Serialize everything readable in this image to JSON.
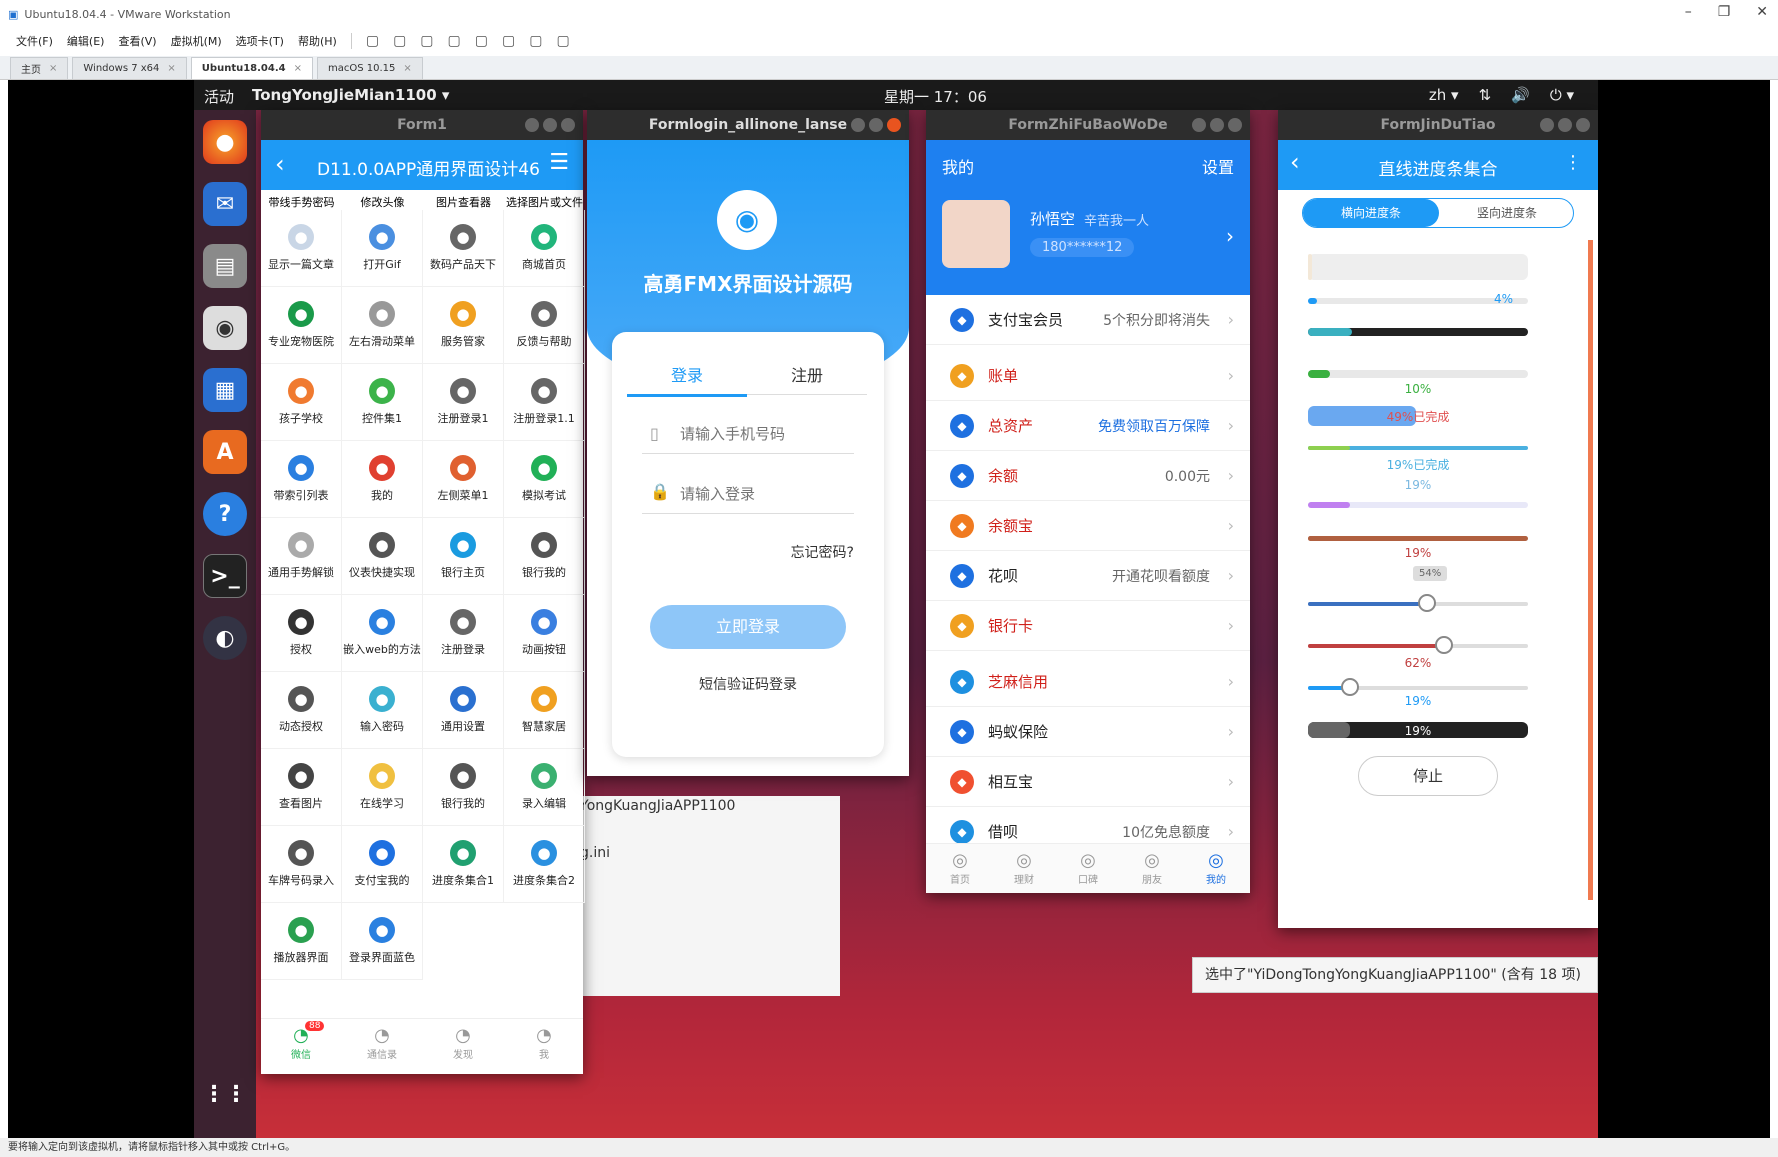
{
  "vmware": {
    "title": "Ubuntu18.04.4 - VMware Workstation",
    "menu": [
      "文件(F)",
      "编辑(E)",
      "查看(V)",
      "虚拟机(M)",
      "选项卡(T)",
      "帮助(H)"
    ],
    "tabs": [
      {
        "label": "主页"
      },
      {
        "label": "Windows 7 x64"
      },
      {
        "label": "Ubuntu18.04.4"
      },
      {
        "label": "macOS 10.15"
      }
    ],
    "status": "要将输入定向到该虚拟机，请将鼠标指针移入其中或按 Ctrl+G。"
  },
  "ubuntu": {
    "activities": "活动",
    "app_menu": "TongYongJieMian1100 ▾",
    "clock": "星期一 17：06",
    "lang": "zh ▾"
  },
  "form1": {
    "title": "Form1",
    "header": "D11.0.0APP通用界面设计46",
    "top_labels": [
      "带线手势密码",
      "修改头像",
      "图片查看器",
      "选择图片或文件"
    ],
    "items": [
      {
        "label": "显示一篇文章",
        "icon": "document-icon",
        "color": "#c9d6e6"
      },
      {
        "label": "打开Gif",
        "icon": "flame-icon",
        "color": "#4a8fe0"
      },
      {
        "label": "数码产品天下",
        "icon": "link-icon",
        "color": "#666"
      },
      {
        "label": "商城首页",
        "icon": "shop-icon",
        "color": "#21b57b"
      },
      {
        "label": "专业宠物医院",
        "icon": "aperture-icon",
        "color": "#1a9a4a"
      },
      {
        "label": "左右滑动菜单",
        "icon": "swipe-icon",
        "color": "#999"
      },
      {
        "label": "服务管家",
        "icon": "service-icon",
        "color": "#f0a020"
      },
      {
        "label": "反馈与帮助",
        "icon": "help-icon",
        "color": "#666"
      },
      {
        "label": "孩子学校",
        "icon": "school-icon",
        "color": "#f07a30"
      },
      {
        "label": "控件集1",
        "icon": "toggle-icon",
        "color": "#3cb34a"
      },
      {
        "label": "注册登录1",
        "icon": "user-add-icon",
        "color": "#666"
      },
      {
        "label": "注册登录1.1",
        "icon": "user-add-icon",
        "color": "#666"
      },
      {
        "label": "带索引列表",
        "icon": "list-icon",
        "color": "#2a7fe0"
      },
      {
        "label": "我的",
        "icon": "mail-icon",
        "color": "#e04030"
      },
      {
        "label": "左侧菜单1",
        "icon": "clipboard-icon",
        "color": "#e06030"
      },
      {
        "label": "模拟考试",
        "icon": "chat-icon",
        "color": "#21b057"
      },
      {
        "label": "通用手势解锁",
        "icon": "phone-icon",
        "color": "#aaa"
      },
      {
        "label": "仪表快捷实现",
        "icon": "compass-icon",
        "color": "#555"
      },
      {
        "label": "银行主页",
        "icon": "pie-icon",
        "color": "#1a9be0"
      },
      {
        "label": "银行我的",
        "icon": "user-icon",
        "color": "#555"
      },
      {
        "label": "授权",
        "icon": "layers-icon",
        "color": "#333"
      },
      {
        "label": "嵌入web的方法",
        "icon": "globe-icon",
        "color": "#2a80e0"
      },
      {
        "label": "注册登录",
        "icon": "send-icon",
        "color": "#666"
      },
      {
        "label": "动画按钮",
        "icon": "gauge-icon",
        "color": "#3a7fe0"
      },
      {
        "label": "动态授权",
        "icon": "camera-icon",
        "color": "#555"
      },
      {
        "label": "输入密码",
        "icon": "fingerprint-icon",
        "color": "#3ab0d0"
      },
      {
        "label": "通用设置",
        "icon": "gear-icon",
        "color": "#2a70d0"
      },
      {
        "label": "智慧家居",
        "icon": "home-icon",
        "color": "#f0a020"
      },
      {
        "label": "查看图片",
        "icon": "image-icon",
        "color": "#444"
      },
      {
        "label": "在线学习",
        "icon": "book-icon",
        "color": "#f0c040"
      },
      {
        "label": "银行我的",
        "icon": "user-icon",
        "color": "#555"
      },
      {
        "label": "录入编辑",
        "icon": "edit-icon",
        "color": "#3ab070"
      },
      {
        "label": "车牌号码录入",
        "icon": "plate-icon",
        "color": "#555"
      },
      {
        "label": "支付宝我的",
        "icon": "alipay-icon",
        "color": "#1e70e0"
      },
      {
        "label": "进度条集合1",
        "icon": "progress-icon",
        "color": "#20a070"
      },
      {
        "label": "进度条集合2",
        "icon": "refresh-icon",
        "color": "#2a90e0"
      },
      {
        "label": "播放器界面",
        "icon": "play-icon",
        "color": "#2aa050"
      },
      {
        "label": "登录界面蓝色",
        "icon": "bot-icon",
        "color": "#2a80e0"
      }
    ],
    "nav": [
      {
        "label": "微信",
        "badge": "88"
      },
      {
        "label": "通信录"
      },
      {
        "label": "发现"
      },
      {
        "label": "我"
      }
    ]
  },
  "login": {
    "title": "Formlogin_allinone_lanse",
    "app_name": "高勇FMX界面设计源码",
    "tab_login": "登录",
    "tab_register": "注册",
    "phone_placeholder": "请输入手机号码",
    "pwd_placeholder": "请输入登录",
    "forgot": "忘记密码?",
    "login_btn": "立即登录",
    "sms_login": "短信验证码登录"
  },
  "alipay": {
    "title": "FormZhiFuBaoWoDe",
    "header_left": "我的",
    "header_right": "设置",
    "user_name": "孙悟空",
    "user_motto": "辛苦我一人",
    "user_phone": "180******12",
    "rows": [
      {
        "label": "支付宝会员",
        "value": "5个积分即将消失",
        "color": "#1e70e0",
        "red": false
      },
      {
        "label": "账单",
        "value": "",
        "color": "#f0a020",
        "red": true
      },
      {
        "label": "总资产",
        "value": "免费领取百万保障",
        "color": "#1e70e0",
        "red": true,
        "blue_value": true
      },
      {
        "label": "余额",
        "value": "0.00元",
        "color": "#1e70e0",
        "red": true
      },
      {
        "label": "余额宝",
        "value": "",
        "color": "#f07a20",
        "red": true
      },
      {
        "label": "花呗",
        "value": "开通花呗看额度",
        "color": "#1e70e0",
        "red": false
      },
      {
        "label": "银行卡",
        "value": "",
        "color": "#f0a020",
        "red": true
      },
      {
        "label": "芝麻信用",
        "value": "",
        "color": "#1e90e0",
        "red": true
      },
      {
        "label": "蚂蚁保险",
        "value": "",
        "color": "#1e70e0",
        "red": false
      },
      {
        "label": "相互宝",
        "value": "",
        "color": "#f05030",
        "red": false
      },
      {
        "label": "借呗",
        "value": "10亿免息额度",
        "color": "#1e90e0",
        "red": false
      }
    ],
    "nav": [
      {
        "label": "首页"
      },
      {
        "label": "理财"
      },
      {
        "label": "口碑"
      },
      {
        "label": "朋友"
      },
      {
        "label": "我的"
      }
    ]
  },
  "progress": {
    "title": "FormJinDuTiao",
    "header": "直线进度条集合",
    "seg_h": "横向进度条",
    "seg_v": "竖向进度条",
    "labels": {
      "p4": "4%",
      "p10": "10%",
      "p49": "49%已完成",
      "p19a": "19%已完成",
      "p19b": "19%",
      "p19c": "19%",
      "slider_tip": "54%",
      "p62": "62%",
      "p19d": "19%",
      "p19e": "19%"
    },
    "values": {
      "bar2": 0.04,
      "bar3": 0.2,
      "bar4": 0.1,
      "bar5": 0.49,
      "bar6": 0.19,
      "bar7": 0.19,
      "bar8": 0.19,
      "slider1": 0.54,
      "slider2": 0.62,
      "slider3": 0.19,
      "slider4": 0.19
    },
    "stop_btn": "停止"
  },
  "files": {
    "name_fragment": "YongKuangJiaAPP1100",
    "ini_fragment": "g.ini",
    "status": "选中了\"YiDongTongYongKuangJiaAPP1100\" (含有 18 项)"
  }
}
